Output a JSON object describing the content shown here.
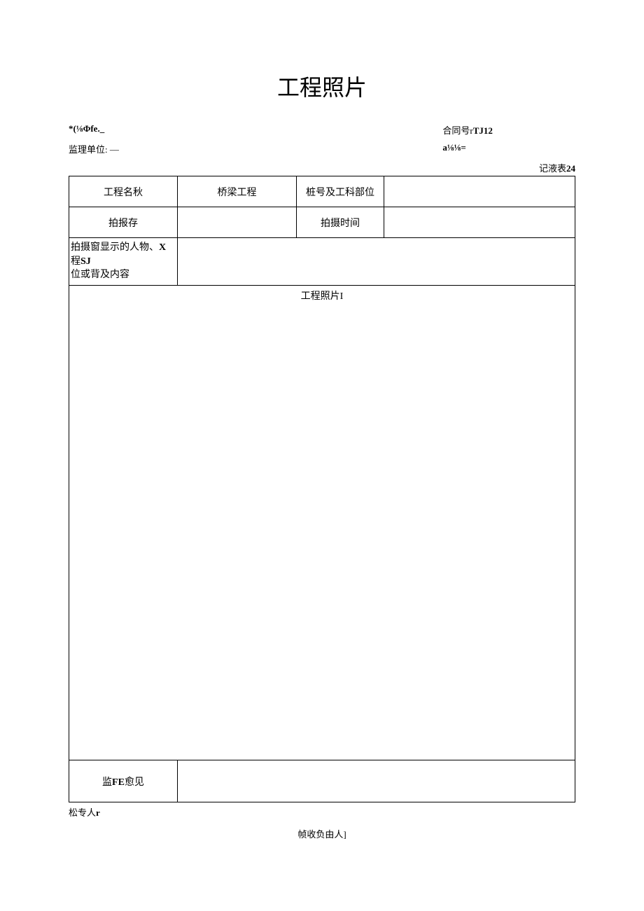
{
  "title": "工程照片",
  "header": {
    "left1": "*(⅛Φfe._",
    "left2_label": "监理单位:",
    "left2_value": "—",
    "right1_label": "合同号r",
    "right1_value": "TJ12",
    "right2": "a⅛⅛="
  },
  "table_note_label": "记液表",
  "table_note_num": "24",
  "rows": {
    "r1c1": "工程名秋",
    "r1c2": "桥梁工程",
    "r1c3": "桩号及工科部位",
    "r1c4": "",
    "r2c1": "拍报存",
    "r2c2": "",
    "r2c3": "拍摄时间",
    "r2c4": "",
    "r3c1_line1": "拍摄窗显示的人物、",
    "r3c1_bold": "X",
    "r3c1_line1b": "程",
    "r3c1_bold2": "SJ",
    "r3c1_line2": "位或背及内容",
    "r3c2": "",
    "photo_title": "工程照片I",
    "opinion_label_pre": "监",
    "opinion_label_bold": "FE",
    "opinion_label_post": "愈见",
    "opinion_value": ""
  },
  "footer1_pre": "松专人",
  "footer1_bold": "r",
  "footer2": "帧收负由人]"
}
